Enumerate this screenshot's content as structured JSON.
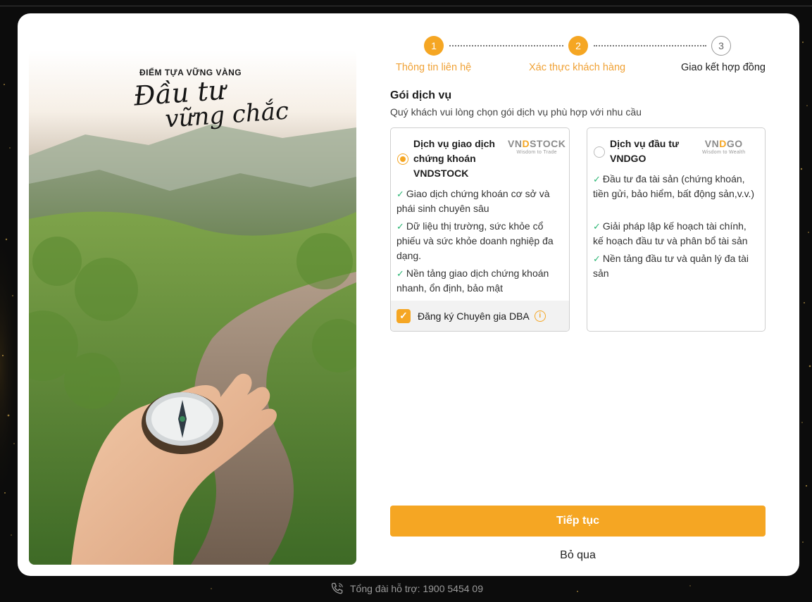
{
  "hero": {
    "tagline": "ĐIỂM TỰA VỮNG VÀNG",
    "script_line1": "Đầu tư",
    "script_line2": "vững chắc"
  },
  "stepper": {
    "steps": [
      {
        "number": "1",
        "label": "Thông tin liên hệ",
        "state": "done"
      },
      {
        "number": "2",
        "label": "Xác thực khách hàng",
        "state": "active"
      },
      {
        "number": "3",
        "label": "Giao kết hợp đồng",
        "state": "todo"
      }
    ]
  },
  "service": {
    "title": "Gói dịch vụ",
    "subtitle": "Quý khách vui lòng chọn gói dịch vụ phù hợp với nhu cầu",
    "packages": [
      {
        "title_lines": [
          "Dịch vụ giao dịch",
          "chứng khoán",
          "VNDSTOCK"
        ],
        "brand_pre": "VN",
        "brand_mark": "D",
        "brand_post": "STOCK",
        "brand_sub": "Wisdom to Trade",
        "selected": true,
        "features": [
          "Giao dịch chứng khoán cơ sở và phái sinh chuyên sâu",
          "Dữ liệu thị trường, sức khỏe cổ phiếu và sức khỏe doanh nghiệp đa dạng.",
          "Nền tảng giao dịch chứng khoán nhanh, ổn định, bảo mật"
        ],
        "addon_label": "Đăng ký Chuyên gia DBA",
        "addon_checked": true
      },
      {
        "title_lines": [
          "Dịch vụ đầu tư",
          "VNDGO"
        ],
        "brand_pre": "VN",
        "brand_mark": "D",
        "brand_post": "GO",
        "brand_sub": "Wisdom to Wealth",
        "selected": false,
        "features": [
          "Đầu tư đa tài sản (chứng khoán, tiền gửi, bảo hiểm, bất động sản,v.v.)",
          "Giải pháp lập kế hoạch tài chính, kế hoạch đầu tư và phân bổ tài sản",
          "Nền tảng đầu tư và quản lý đa tài sản"
        ]
      }
    ]
  },
  "actions": {
    "next_label": "Tiếp tục",
    "skip_label": "Bỏ qua"
  },
  "footer": {
    "support_text": "Tổng đài hỗ trợ: 1900 5454 09"
  },
  "colors": {
    "accent": "#f5a623",
    "check": "#2bb673",
    "background": "#0c0c0c"
  },
  "icons": {
    "phone": "phone-icon",
    "check": "check-icon",
    "info": "info-icon"
  }
}
